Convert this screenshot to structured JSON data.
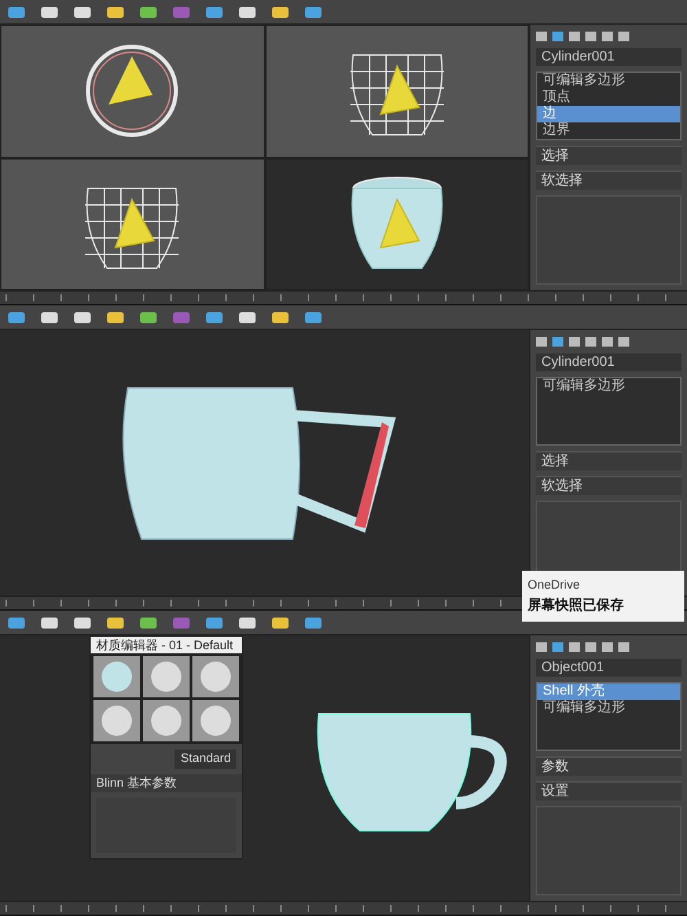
{
  "panels": [
    {
      "kind": "quad",
      "object_field": "Cylinder001",
      "stack": [
        {
          "label": "可编辑多边形",
          "selected": false
        },
        {
          "label": "顶点",
          "selected": false
        },
        {
          "label": "边",
          "selected": true
        },
        {
          "label": "边界",
          "selected": false
        }
      ],
      "rollouts": [
        "选择",
        "软选择"
      ]
    },
    {
      "kind": "single",
      "object_field": "Cylinder001",
      "stack": [
        {
          "label": "可编辑多边形",
          "selected": false
        }
      ],
      "rollouts": [
        "选择",
        "软选择"
      ],
      "notification": {
        "app": "OneDrive",
        "message": "屏幕快照已保存"
      }
    },
    {
      "kind": "material",
      "object_field": "Object001",
      "stack": [
        {
          "label": "Shell 外壳",
          "selected": true
        },
        {
          "label": "可编辑多边形",
          "selected": false
        }
      ],
      "rollouts": [
        "参数",
        "设置"
      ],
      "material_editor": {
        "title": "材质编辑器 - 01 - Default",
        "shader": "Standard",
        "rollout": "Blinn 基本参数"
      }
    }
  ]
}
